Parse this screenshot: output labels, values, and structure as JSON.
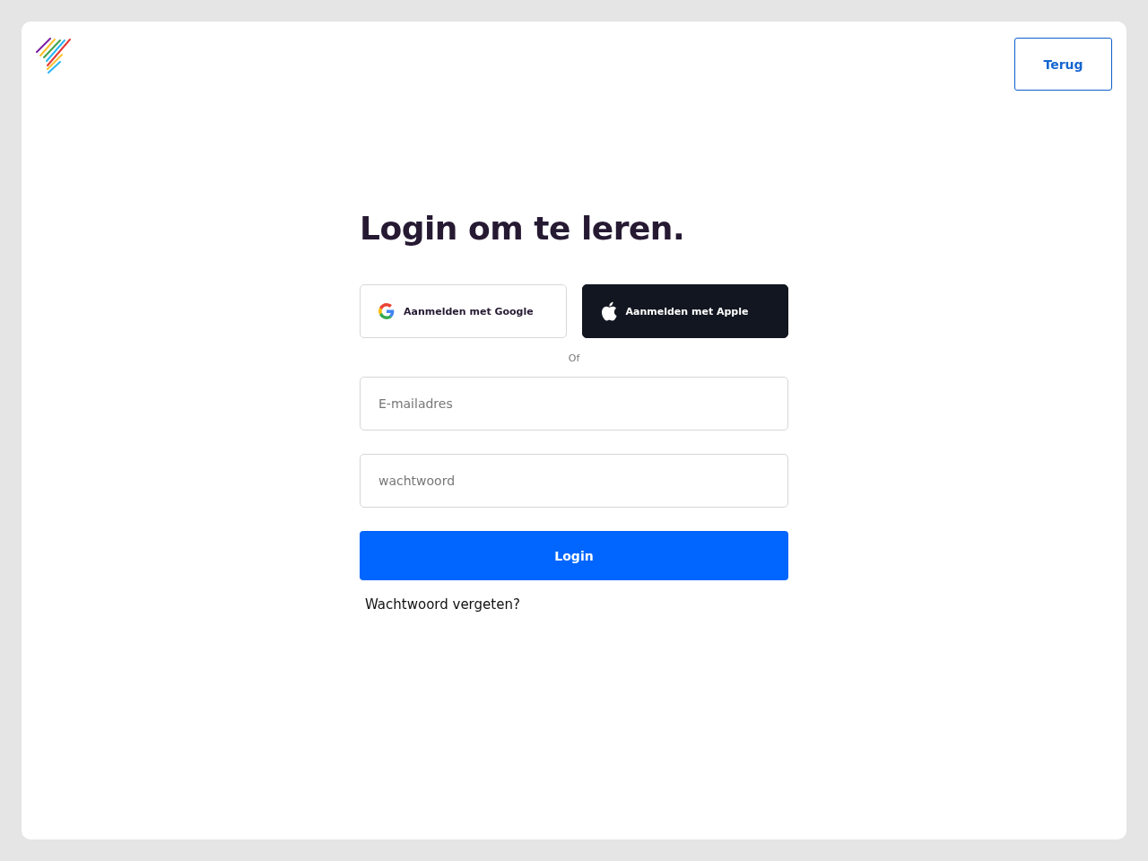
{
  "header": {
    "back_button": "Terug"
  },
  "title": "Login om te leren.",
  "social_buttons": [
    {
      "kind": "google",
      "label": "Aanmelden met Google"
    },
    {
      "kind": "apple",
      "label": "Aanmelden met Apple"
    }
  ],
  "divider": "Of",
  "fields": [
    {
      "placeholder": "E-mailadres"
    },
    {
      "placeholder": "wachtwoord"
    }
  ],
  "login_button": "Login",
  "forgot_link": "Wachtwoord vergeten?"
}
